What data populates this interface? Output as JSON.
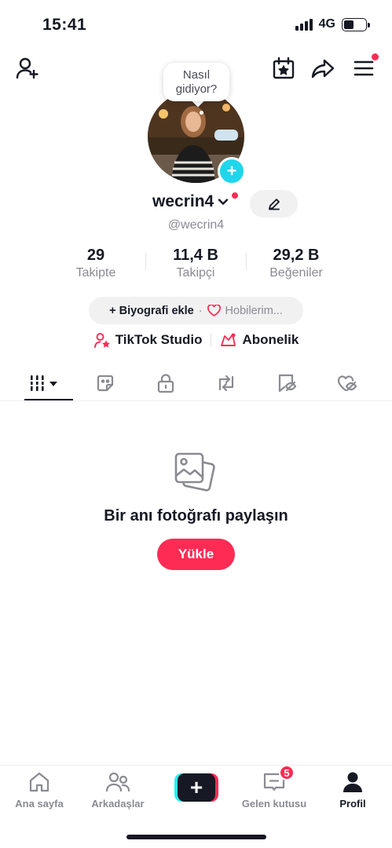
{
  "status_bar": {
    "time": "15:41",
    "network": "4G"
  },
  "profile": {
    "note_bubble": "Nasıl gidiyor?",
    "username": "wecrin4",
    "handle": "@wecrin4"
  },
  "stats": [
    {
      "value": "29",
      "label": "Takipte"
    },
    {
      "value": "11,4 B",
      "label": "Takipçi"
    },
    {
      "value": "29,2 B",
      "label": "Beğeniler"
    }
  ],
  "bio": {
    "add_label": "+ Biyografi ekle",
    "separator": "·",
    "hobby_label": "Hobilerim..."
  },
  "links": {
    "studio": "TikTok Studio",
    "subscription": "Abonelik"
  },
  "empty_state": {
    "message": "Bir anı fotoğrafı paylaşın",
    "button": "Yükle"
  },
  "bottom_nav": {
    "home": "Ana sayfa",
    "friends": "Arkadaşlar",
    "inbox": "Gelen kutusu",
    "inbox_badge": "5",
    "profile": "Profil"
  },
  "colors": {
    "accent": "#fe2c55",
    "cyan": "#20d5ec",
    "text": "#161823",
    "muted": "#8a8b91"
  }
}
